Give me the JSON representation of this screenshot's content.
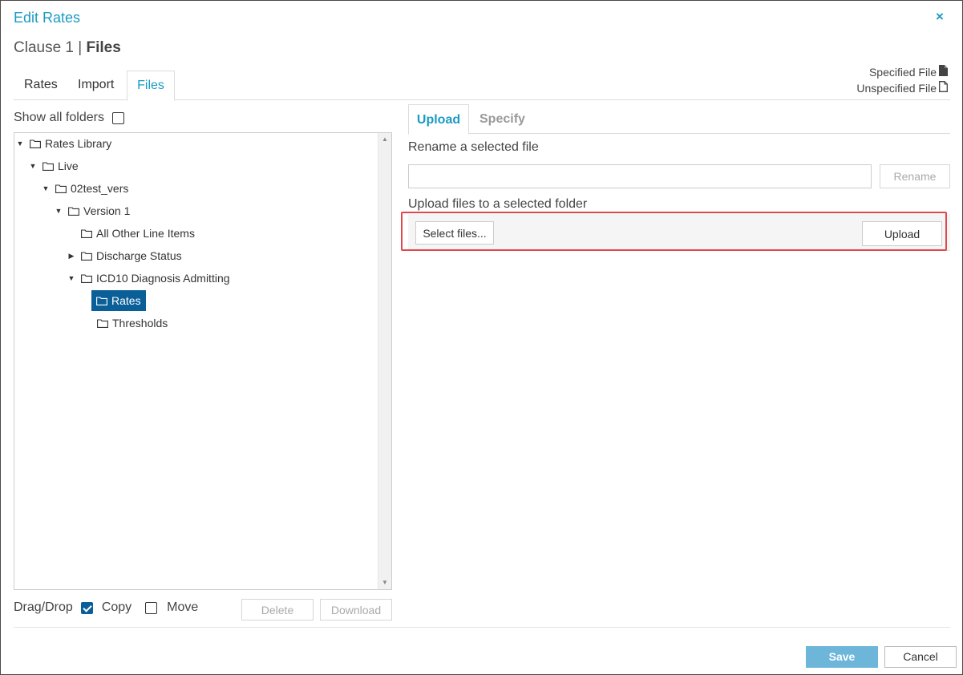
{
  "dialog": {
    "title": "Edit Rates",
    "close_glyph": "×",
    "subtitle_prefix": "Clause 1 | ",
    "subtitle_bold": "Files"
  },
  "legend": {
    "specified": "Specified File",
    "unspecified": "Unspecified File"
  },
  "tabs": [
    {
      "label": "Rates",
      "active": false
    },
    {
      "label": "Import",
      "active": false
    },
    {
      "label": "Files",
      "active": true
    }
  ],
  "left": {
    "show_all_label": "Show all folders",
    "show_all_checked": false,
    "tree": [
      {
        "label": "Rates Library",
        "expanded": true,
        "level": 0
      },
      {
        "label": "Live",
        "expanded": true,
        "level": 1
      },
      {
        "label": "02test_vers",
        "expanded": true,
        "level": 2
      },
      {
        "label": "Version 1",
        "expanded": true,
        "level": 3
      },
      {
        "label": "All Other Line Items",
        "level": 4
      },
      {
        "label": "Discharge Status",
        "expanded": false,
        "level": 4
      },
      {
        "label": "ICD10 Diagnosis Admitting",
        "expanded": true,
        "level": 4
      },
      {
        "label": "Rates",
        "level": 5,
        "selected": true
      },
      {
        "label": "Thresholds",
        "level": 5
      }
    ],
    "dragdrop_label": "Drag/Drop",
    "copy_label": "Copy",
    "copy_checked": true,
    "move_label": "Move",
    "move_checked": false,
    "delete_label": "Delete",
    "download_label": "Download"
  },
  "right": {
    "tabs": [
      {
        "label": "Upload",
        "active": true
      },
      {
        "label": "Specify",
        "active": false
      }
    ],
    "rename_heading": "Rename a selected file",
    "rename_value": "",
    "rename_button": "Rename",
    "upload_heading": "Upload files to a selected folder",
    "select_files_button": "Select files...",
    "upload_button": "Upload"
  },
  "footer": {
    "save_label": "Save",
    "cancel_label": "Cancel"
  },
  "colors": {
    "accent": "#1a9bc4",
    "selected_bg": "#0b5f99",
    "highlight": "#e0474c",
    "save_bg": "#6db6da"
  }
}
